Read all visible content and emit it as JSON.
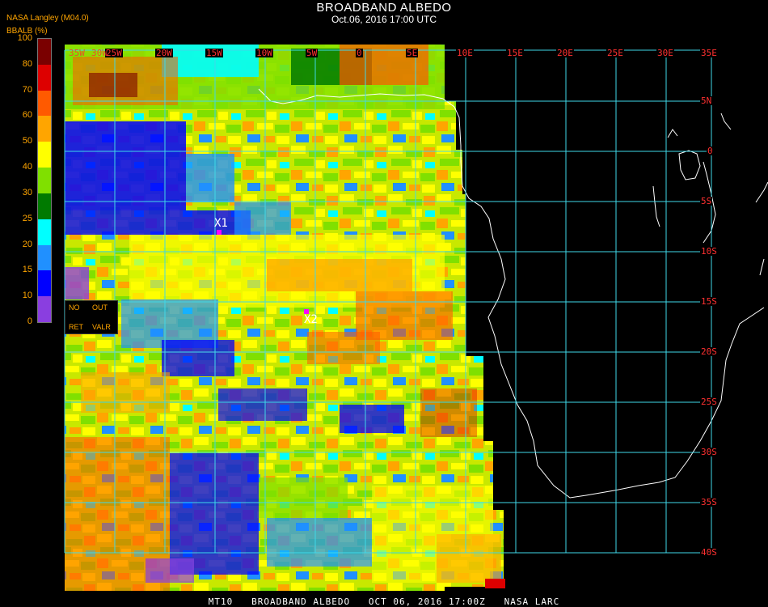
{
  "header": {
    "title": "BROADBAND ALBEDO",
    "subtitle": "Oct.06, 2016 17:00 UTC",
    "source": "NASA Langley (M04.0)",
    "unit_label": "BBALB (%)"
  },
  "colorbar": {
    "ticks": [
      "100",
      "80",
      "70",
      "60",
      "50",
      "40",
      "30",
      "25",
      "20",
      "15",
      "10",
      "0"
    ],
    "colors": [
      "#7a0000",
      "#dd0000",
      "#ff5a00",
      "#ffa500",
      "#ffff00",
      "#80e000",
      "#007a00",
      "#00ffff",
      "#2090ff",
      "#0000ff",
      "#8a3ee0"
    ]
  },
  "no_retrieval_legend": {
    "no": "NO",
    "out": "OUT",
    "ret": "RET",
    "valr": "VALR"
  },
  "grid": {
    "lon_labels": [
      "35W",
      "30W",
      "25W",
      "20W",
      "15W",
      "10W",
      "5W",
      "0",
      "5E",
      "10E",
      "15E",
      "20E",
      "25E",
      "30E",
      "35E"
    ],
    "lat_labels": [
      "5N",
      "0",
      "5S",
      "10S",
      "15S",
      "20S",
      "25S",
      "30S",
      "35S",
      "40S"
    ]
  },
  "markers": [
    {
      "label": "X1"
    },
    {
      "label": "X2"
    }
  ],
  "footer": "MT10   BROADBAND ALBEDO   OCT 06, 2016 17:00Z   NASA LARC"
}
